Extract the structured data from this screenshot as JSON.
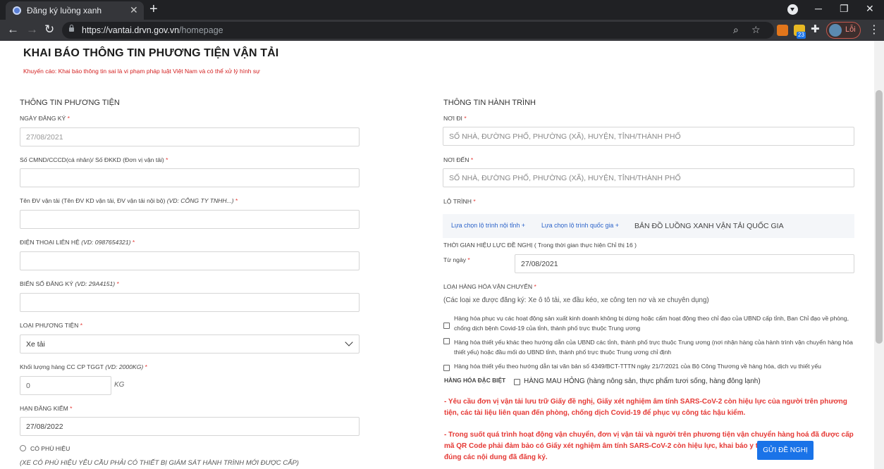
{
  "browser": {
    "tab_title": "Đăng ký luồng xanh",
    "tab_close": "✕",
    "new_tab": "+",
    "url_host": "https://vantai.drvn.gov.vn",
    "url_path": "/homepage",
    "profile_label": "Lỗi",
    "extension_badge": "23",
    "icons": [
      "chrome-favicon",
      "back-icon",
      "forward-icon",
      "reload-icon",
      "lock-icon",
      "zoom-icon",
      "star-icon",
      "metamask-icon",
      "extension-icon",
      "puzzle-icon",
      "avatar",
      "kebab-menu-icon",
      "minimize-icon",
      "maximize-icon",
      "close-window-icon"
    ],
    "accent": "#1a73e8"
  },
  "page": {
    "title": "KHAI BÁO THÔNG TIN PHƯƠNG TIỆN VẬN TẢI",
    "warning": "Khuyến cáo: Khai báo thông tin sai là vi phạm pháp luật Việt Nam và có thể xử lý hình sự",
    "warning_color": "#d32020"
  },
  "vehicle": {
    "section_title": "THÔNG TIN PHƯƠNG TIỆN",
    "reg_date_label": "NGÀY ĐĂNG KÝ",
    "reg_date_value": "27/08/2021",
    "id_label": "Số CMND/CCCD(cá nhân)/ Số ĐKKD (Đơn vị vận tải)",
    "id_value": "",
    "company_label": "Tên ĐV vận tải (Tên ĐV KD vận tải, ĐV vận tải nội bộ)",
    "company_hint": "(VD: CÔNG TY TNHH...)",
    "company_value": "",
    "phone_label": "ĐIỆN THOẠI LIÊN HỆ",
    "phone_hint": "(VD: 0987654321)",
    "phone_value": "",
    "plate_label": "BIỂN SỐ ĐĂNG KÝ",
    "plate_hint": "(VD: 29A4151)",
    "plate_value": "",
    "type_label": "LOẠI PHƯƠNG TIỆN",
    "type_value": "Xe tải",
    "weight_label": "Khối lượng hàng CC CP TGGT",
    "weight_hint": "(VD: 2000KG)",
    "weight_value": "0",
    "weight_unit": "KG",
    "inspection_label": "HẠN ĐĂNG KIỂM",
    "inspection_value": "27/08/2022",
    "badge_label": "CÓ PHÙ HIỆU",
    "badge_note": "(XE CÓ PHÙ HIỆU YÊU CẦU PHẢI CÓ THIẾT BỊ GIÁM SÁT HÀNH TRÌNH MỚI ĐƯỢC CẤP)",
    "required_mark": "*"
  },
  "journey": {
    "section_title": "THÔNG TIN HÀNH TRÌNH",
    "from_label": "NƠI ĐI",
    "from_placeholder": "SỐ NHÀ, ĐƯỜNG PHỐ, PHƯỜNG (XÃ), HUYỆN, TỈNH/THÀNH PHỐ",
    "to_label": "NƠI ĐẾN",
    "to_placeholder": "SỐ NHÀ, ĐƯỜNG PHỐ, PHƯỜNG (XÃ), HUYỆN, TỈNH/THÀNH PHỐ",
    "route_label": "LỘ TRÌNH",
    "route_local": "Lựa chọn lộ trình nội tỉnh",
    "route_national": "Lựa chọn lộ trình quốc gia",
    "route_add_icon": "+",
    "route_map": "BẢN ĐỒ LUỒNG XANH VẬN TẢI QUỐC GIA",
    "validity_label": "THỜI GIAN HIỆU LỰC ĐỀ NGHỊ ( Trong thời gian thực hiện Chỉ thị 16 )",
    "from_date_label": "Từ ngày",
    "from_date_value": "27/08/2021",
    "goods_label": "LOẠI HÀNG HÓA VẬN CHUYỂN",
    "goods_note": "(Các loại xe được đăng ký: Xe ô tô tải, xe đầu kéo, xe công ten nơ và xe chuyên dụng)",
    "goods_options": [
      "Hàng hóa phục vụ các hoạt động sản xuất kinh doanh không bị dừng hoặc cấm hoạt động theo chỉ đạo của UBND cấp tỉnh, Ban Chỉ đạo về phòng, chống dịch bệnh Covid-19 của tỉnh, thành phố trực thuộc Trung ương",
      "Hàng hóa thiết yếu khác theo hướng dẫn của UBND các tỉnh, thành phố trực thuộc Trung ương (nơi nhận hàng của hành trình vận chuyển hàng hóa thiết yếu) hoặc đầu mối do UBND tỉnh, thành phố trực thuộc Trung ương chỉ định",
      "Hàng hóa thiết yếu theo hướng dẫn tại văn bản số 4349/BCT-TTTN ngày 21/7/2021 của Bộ Công Thương về hàng hóa, dịch vụ thiết yếu"
    ],
    "special_label": "HÀNG HÓA ĐẶC BIỆT",
    "special_option": "HÀNG MAU HỎNG (hàng nông sản, thực phẩm tươi sống, hàng đông lạnh)",
    "notice_1": "- Yêu cầu đơn vị vận tải lưu trữ Giấy đề nghị, Giấy xét nghiệm âm tính SARS-CoV-2 còn hiệu lực của người trên phương tiện, các tài liệu liên quan đến phòng, chống dịch Covid-19 để phục vụ công tác hậu kiểm.",
    "notice_2_part_a": "- Trong suốt quá trình hoạt động vận chuyển, đơn vị vận tải và người trên phương tiện vận chuyển hàng hoá đã được cấp mã QR Code phải đảm bảo có Giấy xét nghiệm âm tính SARS-CoV-2 còn hiệu lực, khai báo y tế, th",
    "notice_2_part_b": "đúng các nội dung đã đăng ký.",
    "submit_label": "GỬI ĐỀ NGHỊ"
  }
}
